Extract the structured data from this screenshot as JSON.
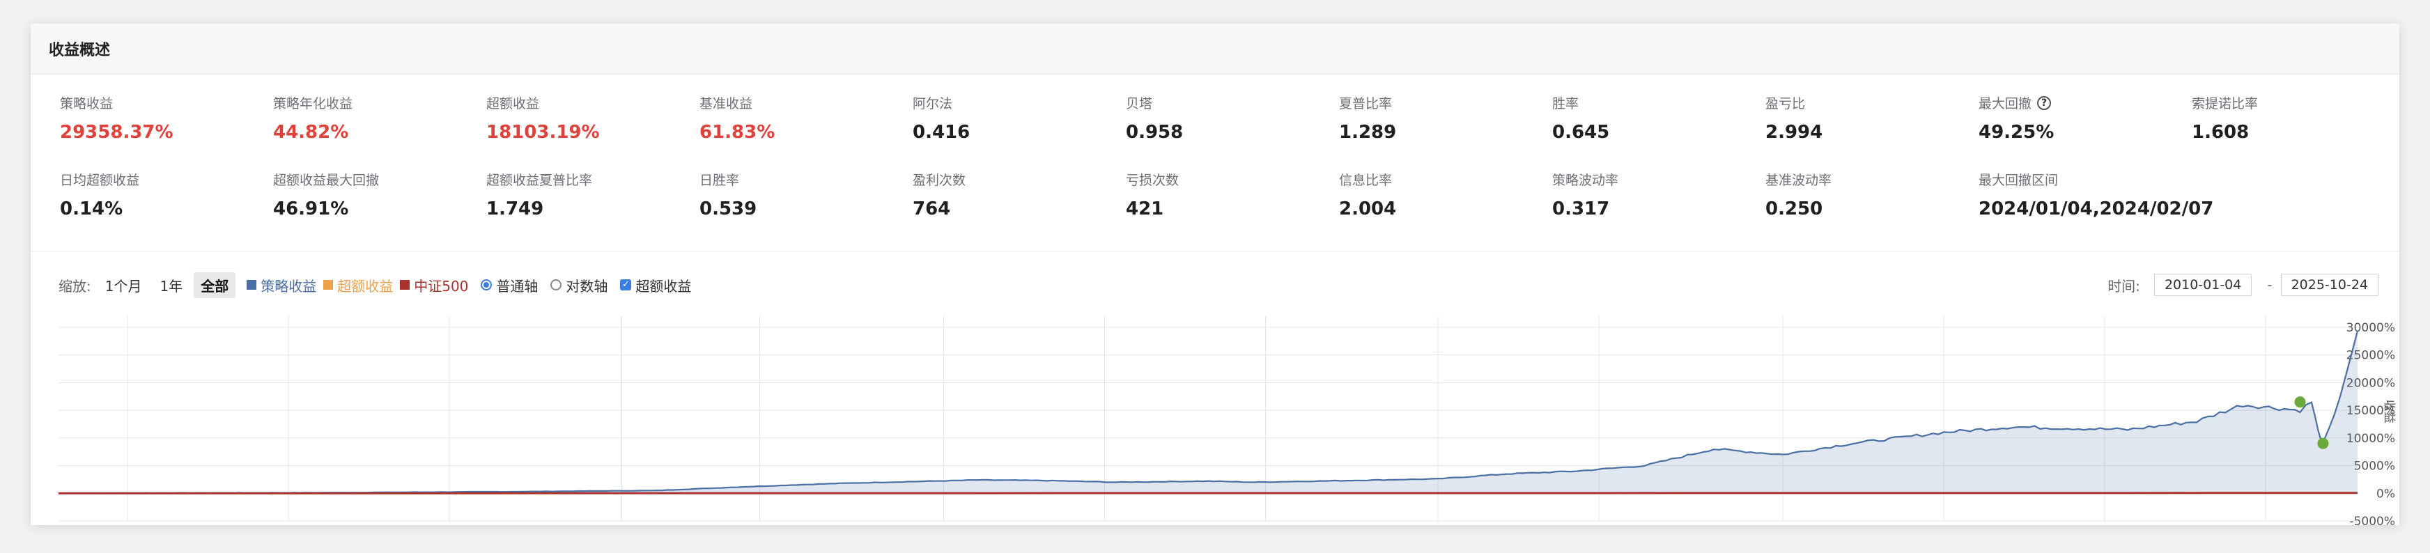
{
  "section_title": "收益概述",
  "stats_row1": [
    {
      "label": "策略收益",
      "value": "29358.37%",
      "red": true
    },
    {
      "label": "策略年化收益",
      "value": "44.82%",
      "red": true
    },
    {
      "label": "超额收益",
      "value": "18103.19%",
      "red": true
    },
    {
      "label": "基准收益",
      "value": "61.83%",
      "red": true
    },
    {
      "label": "阿尔法",
      "value": "0.416"
    },
    {
      "label": "贝塔",
      "value": "0.958"
    },
    {
      "label": "夏普比率",
      "value": "1.289"
    },
    {
      "label": "胜率",
      "value": "0.645"
    },
    {
      "label": "盈亏比",
      "value": "2.994"
    },
    {
      "label": "最大回撤",
      "value": "49.25%",
      "help": "?"
    },
    {
      "label": "索提诺比率",
      "value": "1.608"
    }
  ],
  "stats_row2": [
    {
      "label": "日均超额收益",
      "value": "0.14%"
    },
    {
      "label": "超额收益最大回撤",
      "value": "46.91%"
    },
    {
      "label": "超额收益夏普比率",
      "value": "1.749"
    },
    {
      "label": "日胜率",
      "value": "0.539"
    },
    {
      "label": "盈利次数",
      "value": "764"
    },
    {
      "label": "亏损次数",
      "value": "421"
    },
    {
      "label": "信息比率",
      "value": "2.004"
    },
    {
      "label": "策略波动率",
      "value": "0.317"
    },
    {
      "label": "基准波动率",
      "value": "0.250"
    },
    {
      "label": "最大回撤区间",
      "value": "2024/01/04,2024/02/07"
    }
  ],
  "toolbar": {
    "zoom_label": "缩放:",
    "zoom_buttons": [
      "1个月",
      "1年",
      "全部"
    ],
    "legend": [
      {
        "name": "策略收益",
        "color": "#4a6fa5"
      },
      {
        "name": "超额收益",
        "color": "#f0a04b"
      },
      {
        "name": "中证500",
        "color": "#a8322d"
      }
    ],
    "axis_normal": "普通轴",
    "axis_log": "对数轴",
    "excess_toggle": "超额收益",
    "time_label": "时间:",
    "start_date": "2010-01-04",
    "date_sep": "-",
    "end_date": "2025-10-24"
  },
  "chart_data": {
    "type": "area",
    "y_ticks": [
      "30000%",
      "25000%",
      "20000%",
      "15000%",
      "10000%",
      "5000%",
      "0%",
      "-5000%"
    ],
    "y_values": [
      30000,
      25000,
      20000,
      15000,
      10000,
      5000,
      0,
      -5000
    ],
    "ylim": [
      -5000,
      32000
    ],
    "y_axis_label": "收益",
    "grid": true,
    "series": [
      {
        "name": "策略收益",
        "color": "#4a6fa5",
        "x_fraction": [
          0,
          0.1,
          0.2,
          0.26,
          0.3,
          0.34,
          0.36,
          0.4,
          0.43,
          0.46,
          0.5,
          0.52,
          0.56,
          0.6,
          0.63,
          0.66,
          0.69,
          0.72,
          0.75,
          0.78,
          0.82,
          0.85,
          0.9,
          0.93,
          0.95,
          0.975,
          0.98,
          0.983,
          0.985,
          0.99,
          1.0
        ],
        "values": [
          0,
          80,
          300,
          500,
          1200,
          1800,
          2000,
          2400,
          2300,
          2000,
          2200,
          2000,
          2300,
          2600,
          3500,
          4000,
          5000,
          8000,
          7000,
          9000,
          11000,
          12000,
          11500,
          13000,
          16000,
          15000,
          16500,
          11000,
          9000,
          14000,
          29358
        ]
      },
      {
        "name": "中证500",
        "color": "#a8322d",
        "x_fraction": [
          0,
          0.5,
          1.0
        ],
        "values": [
          0,
          30,
          62
        ]
      }
    ],
    "drawdown_points": [
      {
        "date": "2024/01/04",
        "value": 16500
      },
      {
        "date": "2024/02/07",
        "value": 9000
      }
    ]
  }
}
